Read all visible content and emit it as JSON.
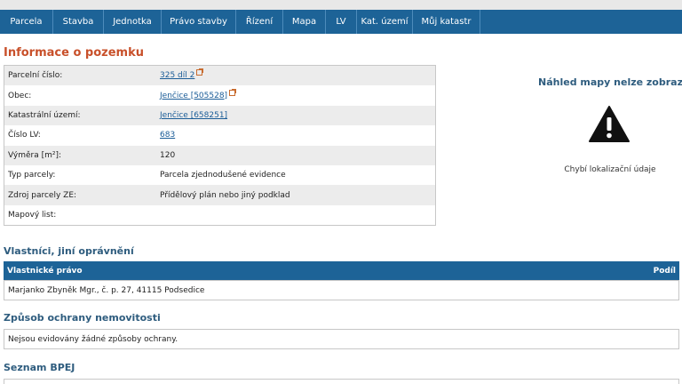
{
  "nav": {
    "items": [
      "Parcela",
      "Stavba",
      "Jednotka",
      "Právo stavby",
      "Řízení",
      "Mapa",
      "LV",
      "Kat. území",
      "Můj katastr"
    ]
  },
  "info": {
    "title": "Informace o pozemku",
    "rows": [
      {
        "label": "Parcelní číslo:",
        "value": "325 díl 2"
      },
      {
        "label": "Obec:",
        "value": "Jenčice [505528]"
      },
      {
        "label": "Katastrální území:",
        "value": "Jenčice [658251]"
      },
      {
        "label": "Číslo LV:",
        "value": "683"
      },
      {
        "label": "Výměra [m²]:",
        "value": "120"
      },
      {
        "label": "Typ parcely:",
        "value": "Parcela zjednodušené evidence"
      },
      {
        "label": "Zdroj parcely ZE:",
        "value": "Přídělový plán nebo jiný podklad"
      },
      {
        "label": "Mapový list:",
        "value": ""
      }
    ]
  },
  "map": {
    "title": "Náhled mapy nelze zobrazit",
    "note": "Chybí lokalizační údaje",
    "icon": "warning-triangle-icon"
  },
  "owners": {
    "title": "Vlastníci, jiní oprávnění",
    "col_right_label": "Vlastnické právo",
    "col_share_label": "Podíl",
    "row": "Marjanko Zbyněk Mgr., č. p. 27, 41115 Podsedice"
  },
  "protection": {
    "title": "Způsob ochrany nemovitosti",
    "text": "Nejsou evidovány žádné způsoby ochrany."
  },
  "bpej": {
    "title": "Seznam BPEJ"
  },
  "colors": {
    "nav_bg": "#1d6397",
    "accent_orange": "#c8502a",
    "heading_blue": "#2e5c7e",
    "link": "#1a5c97"
  }
}
